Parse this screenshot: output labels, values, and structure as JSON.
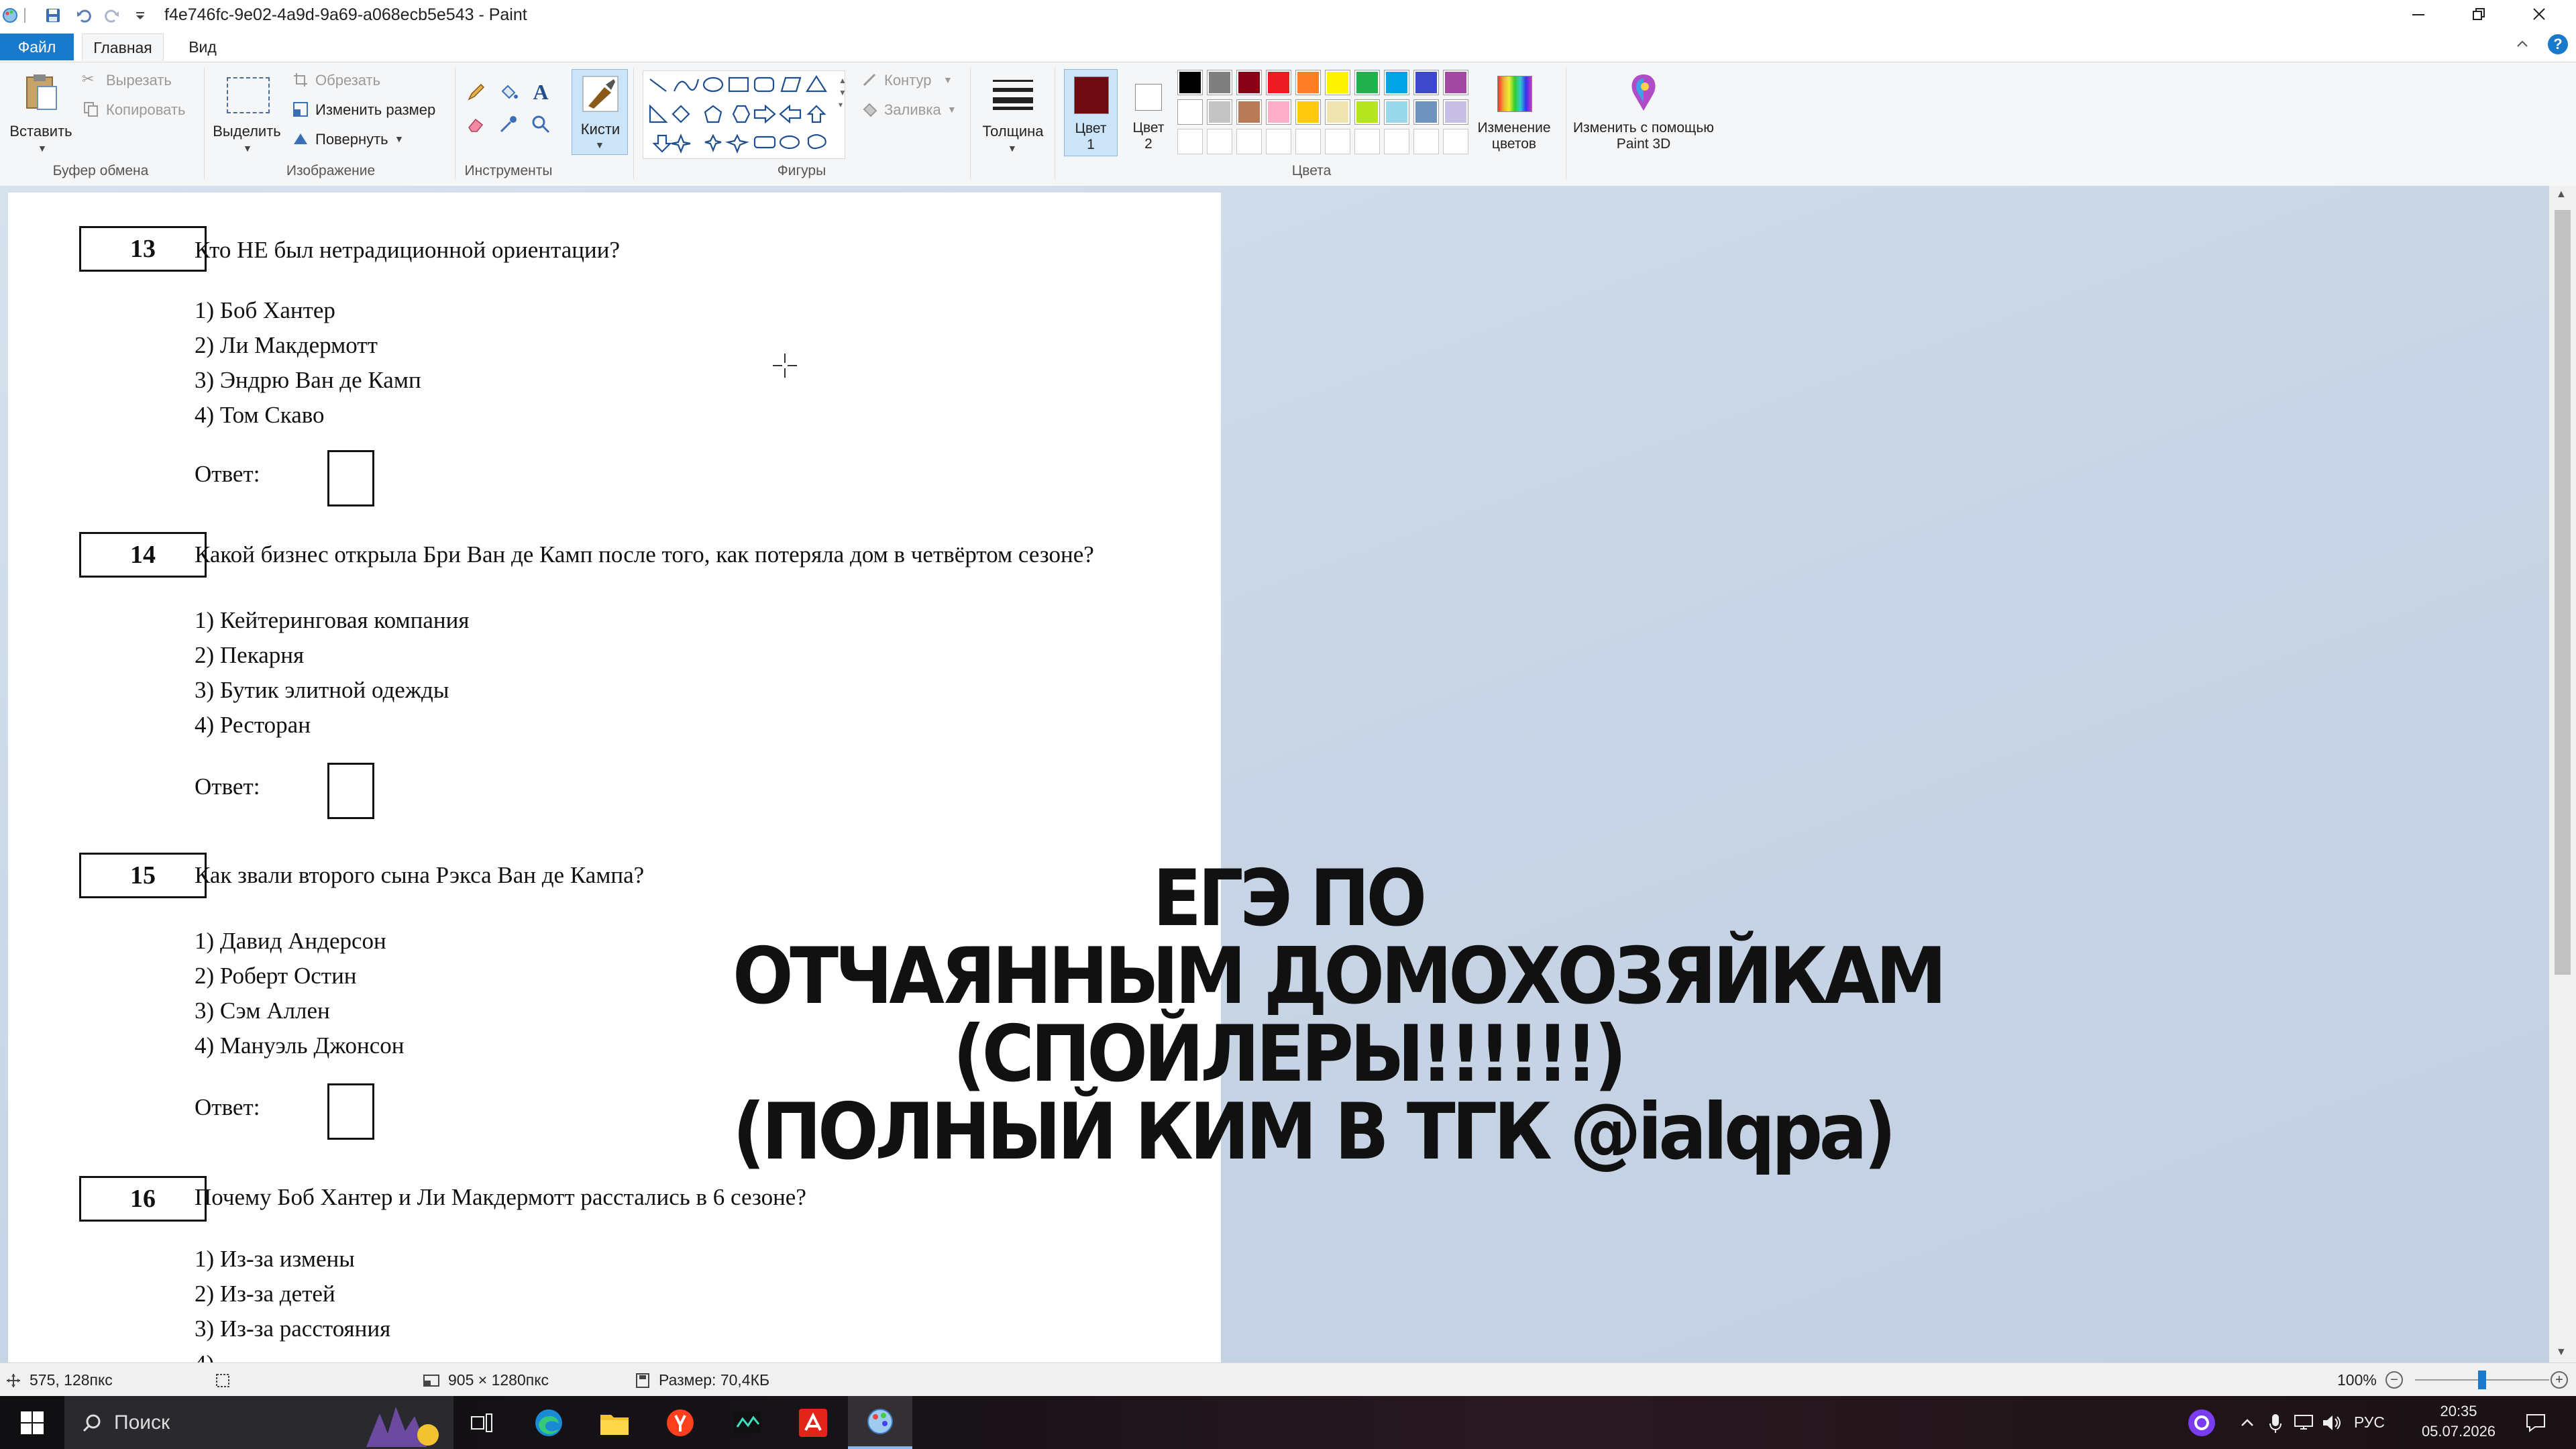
{
  "window": {
    "title": "f4e746fc-9e02-4a9d-9a69-a068ecb5e543 - Paint"
  },
  "tabs": [
    "Файл",
    "Главная",
    "Вид"
  ],
  "ribbon": {
    "clipboard": {
      "paste": "Вставить",
      "cut": "Вырезать",
      "copy": "Копировать",
      "group": "Буфер обмена"
    },
    "image": {
      "select": "Выделить",
      "crop": "Обрезать",
      "resize": "Изменить размер",
      "rotate": "Повернуть",
      "group": "Изображение"
    },
    "tools": {
      "group": "Инструменты"
    },
    "brushes": {
      "label": "Кисти"
    },
    "shapes": {
      "outline": "Контур",
      "fill": "Заливка",
      "group": "Фигуры"
    },
    "size": {
      "label": "Толщина"
    },
    "colors": {
      "color1_label": "Цвет",
      "color1_num": "1",
      "color2_label": "Цвет",
      "color2_num": "2",
      "edit_label": "Изменение цветов",
      "group": "Цвета",
      "color1": "#6e0a12",
      "color2": "#ffffff",
      "palette_row1": [
        "#000000",
        "#7f7f7f",
        "#880015",
        "#ed1c24",
        "#ff7f27",
        "#fff200",
        "#22b14c",
        "#00a2e8",
        "#3f48cc",
        "#a349a4"
      ],
      "palette_row2": [
        "#ffffff",
        "#c3c3c3",
        "#b97a57",
        "#ffaec9",
        "#ffc90e",
        "#efe4b0",
        "#b5e61d",
        "#99d9ea",
        "#7092be",
        "#c8bfe7"
      ]
    },
    "paint3d": {
      "label": "Изменить с помощью Paint 3D"
    }
  },
  "document": {
    "questions": [
      {
        "num": "13",
        "text": "Кто НЕ был нетрадиционной ориентации?",
        "options": [
          "1)  Боб Хантер",
          "2)  Ли Макдермотт",
          "3)  Эндрю Ван де Камп",
          "4)  Том Скаво"
        ],
        "answer_label": "Ответ:"
      },
      {
        "num": "14",
        "text": "Какой бизнес открыла Бри Ван де Камп после того, как потеряла дом в четвёртом сезоне?",
        "options": [
          "1)  Кейтеринговая компания",
          "2)  Пекарня",
          "3)  Бутик элитной одежды",
          "4)  Ресторан"
        ],
        "answer_label": "Ответ:"
      },
      {
        "num": "15",
        "text": "Как звали второго сына Рэкса Ван де Кампа?",
        "options": [
          "1)  Давид Андерсон",
          "2)  Роберт Остин",
          "3)  Сэм Аллен",
          "4)  Мануэль Джонсон"
        ],
        "answer_label": "Ответ:"
      },
      {
        "num": "16",
        "text": "Почему Боб Хантер и Ли Макдермотт расстались в 6 сезоне?",
        "options": [
          "1)  Из-за измены",
          "2)  Из-за детей",
          "3)  Из-за расстояния"
        ],
        "answer_label": ""
      }
    ],
    "overlay": [
      "ЕГЭ ПО",
      "ОТЧАЯННЫМ ДОМОХОЗЯЙКАМ",
      "(СПОЙЛЕРЫ!!!!!!)",
      "(ПОЛНЫЙ КИМ В ТГК @ialqpa)"
    ]
  },
  "statusbar": {
    "cursor_pos": "575, 128пкс",
    "image_size": "905 × 1280пкс",
    "file_size": "Размер: 70,4КБ",
    "zoom": "100%",
    "zoom_fraction": 0.5
  },
  "taskbar": {
    "search_placeholder": "Поиск",
    "language": "РУС",
    "time": "20:35",
    "date": "05.07.2026"
  }
}
